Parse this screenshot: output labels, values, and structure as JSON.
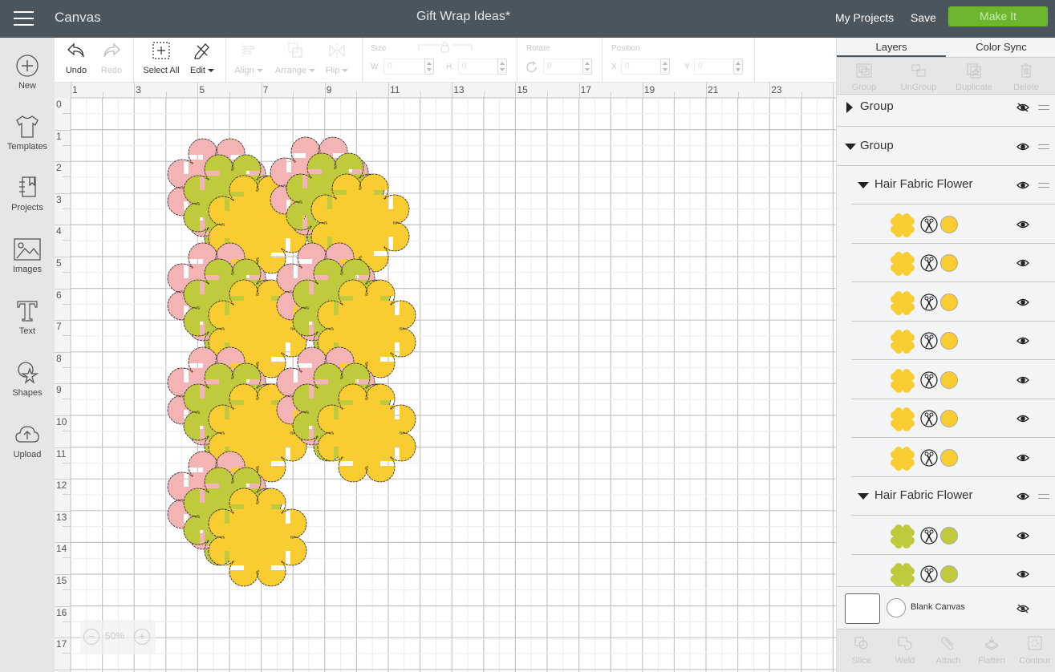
{
  "header": {
    "app_title": "Canvas",
    "document_title": "Gift Wrap Ideas*",
    "my_projects": "My Projects",
    "save": "Save",
    "make_it": "Make It",
    "make_it_color": "#6cb72e"
  },
  "sidebar": {
    "items": [
      {
        "label": "New",
        "icon": "plus-circle-icon"
      },
      {
        "label": "Templates",
        "icon": "tshirt-icon"
      },
      {
        "label": "Projects",
        "icon": "notebook-icon"
      },
      {
        "label": "Images",
        "icon": "image-icon"
      },
      {
        "label": "Text",
        "icon": "text-t-icon"
      },
      {
        "label": "Shapes",
        "icon": "shapes-icon"
      },
      {
        "label": "Upload",
        "icon": "cloud-upload-icon"
      }
    ]
  },
  "toolbar": {
    "undo": "Undo",
    "redo": "Redo",
    "select_all": "Select All",
    "edit": "Edit",
    "align": "Align",
    "arrange": "Arrange",
    "flip": "Flip",
    "size": {
      "label": "Size",
      "w_label": "W",
      "h_label": "H",
      "w_value": "0",
      "h_value": "0"
    },
    "rotate": {
      "label": "Rotate",
      "value": "0"
    },
    "position": {
      "label": "Position",
      "x_label": "X",
      "y_label": "Y",
      "x_value": "0",
      "y_value": "0"
    }
  },
  "canvas": {
    "ruler_top_labels": [
      "1",
      "3",
      "5",
      "7",
      "9",
      "11",
      "13",
      "15",
      "17",
      "19",
      "21",
      "23"
    ],
    "ruler_left_labels": [
      "0",
      "1",
      "2",
      "3",
      "4",
      "5",
      "6",
      "7",
      "8",
      "9",
      "10",
      "11",
      "12",
      "13",
      "14",
      "15",
      "16",
      "17"
    ],
    "zoom": "50%",
    "zoom_out": "−",
    "zoom_in": "+",
    "colors": {
      "pink": "#f4b4b6",
      "green": "#bfca3c",
      "yellow": "#f9cd32"
    }
  },
  "panel": {
    "tabs": [
      {
        "label": "Layers",
        "active": true
      },
      {
        "label": "Color Sync",
        "active": false
      }
    ],
    "tools": [
      "Group",
      "UnGroup",
      "Duplicate",
      "Delete"
    ],
    "layers": [
      {
        "type": "group",
        "name": "Group",
        "expanded": false,
        "visible": false
      },
      {
        "type": "group",
        "name": "Group",
        "expanded": true,
        "visible": true
      },
      {
        "type": "subgroup",
        "name": "Hair Fabric Flower",
        "expanded": true,
        "visible": true
      },
      {
        "type": "shape",
        "color": "#f9cd32",
        "operation": "cut",
        "visible": true
      },
      {
        "type": "shape",
        "color": "#f9cd32",
        "operation": "cut",
        "visible": true
      },
      {
        "type": "shape",
        "color": "#f9cd32",
        "operation": "cut",
        "visible": true
      },
      {
        "type": "shape",
        "color": "#f9cd32",
        "operation": "cut",
        "visible": true
      },
      {
        "type": "shape",
        "color": "#f9cd32",
        "operation": "cut",
        "visible": true
      },
      {
        "type": "shape",
        "color": "#f9cd32",
        "operation": "cut",
        "visible": true
      },
      {
        "type": "shape",
        "color": "#f9cd32",
        "operation": "cut",
        "visible": true
      },
      {
        "type": "subgroup",
        "name": "Hair Fabric Flower",
        "expanded": true,
        "visible": true
      },
      {
        "type": "shape",
        "color": "#bfca3c",
        "operation": "cut",
        "visible": true
      },
      {
        "type": "shape",
        "color": "#bfca3c",
        "operation": "cut",
        "visible": true
      }
    ],
    "blank_canvas": {
      "label": "Blank Canvas",
      "visible": false
    },
    "bottom_tools": [
      "Slice",
      "Weld",
      "Attach",
      "Flatten",
      "Contour"
    ]
  }
}
